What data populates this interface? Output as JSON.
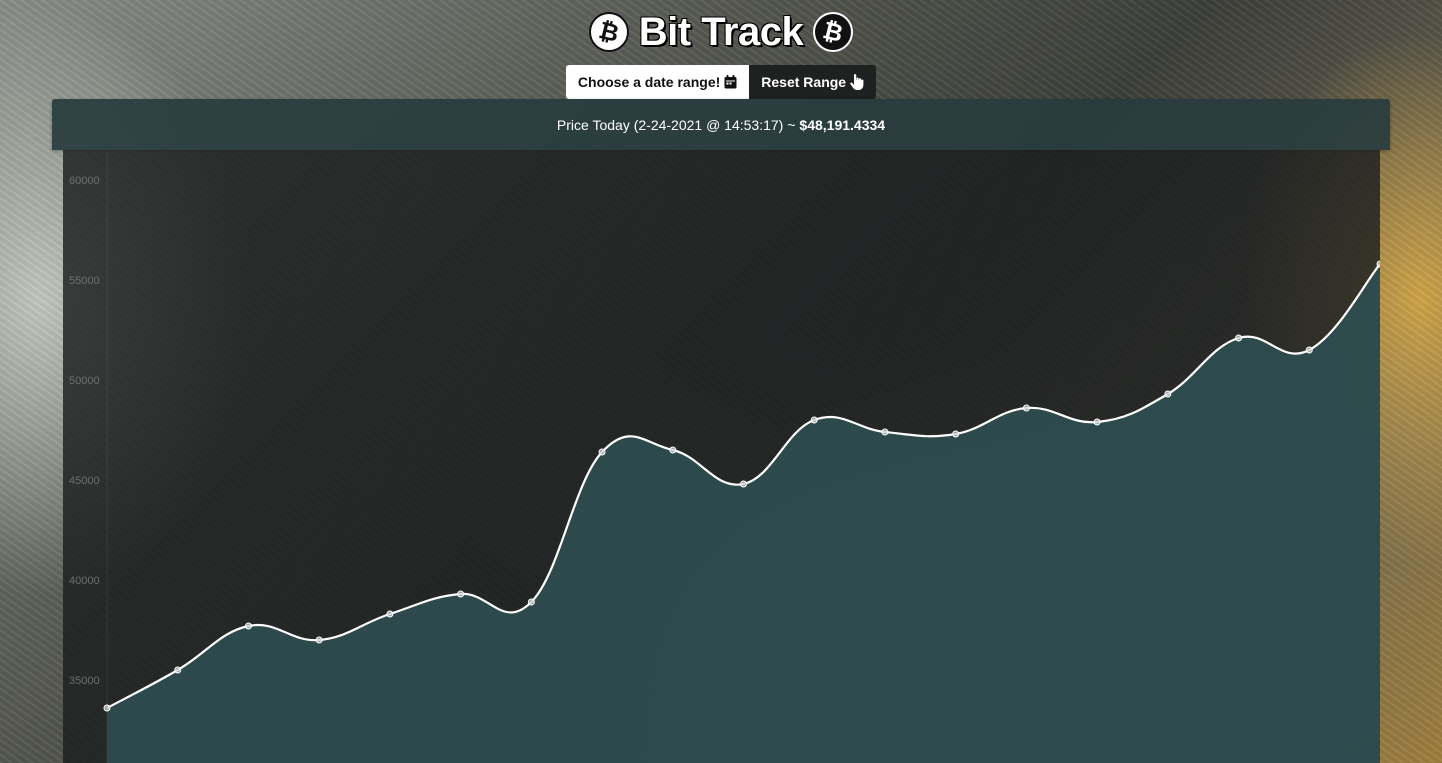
{
  "header": {
    "title": "Bit Track",
    "left_icon": "bitcoin-icon",
    "right_icon": "bitcoin-icon"
  },
  "controls": {
    "date_range_label": "Choose a date range!",
    "date_range_icon": "calendar-icon",
    "reset_label": "Reset Range",
    "reset_icon": "hand-pointer-icon"
  },
  "price_today": {
    "label": "Price Today (2-24-2021 @ 14:53:17) ~",
    "value": "$48,191.4334"
  },
  "colors": {
    "panel_header": "#2d4447",
    "chart_fill": "#2f4f52",
    "line": "#ffffff",
    "tick_text": "#6b6f70"
  },
  "chart_data": {
    "type": "line",
    "title": "",
    "xlabel": "",
    "ylabel": "",
    "ylim": [
      32500,
      61000
    ],
    "yticks": [
      35000,
      40000,
      45000,
      50000,
      55000,
      60000
    ],
    "values": [
      33600,
      35500,
      37700,
      37000,
      38300,
      39300,
      38900,
      46400,
      46500,
      44800,
      48000,
      47400,
      47300,
      48600,
      47900,
      49300,
      52100,
      51500,
      55800
    ],
    "grid": false,
    "legend": "none",
    "fill": true
  }
}
